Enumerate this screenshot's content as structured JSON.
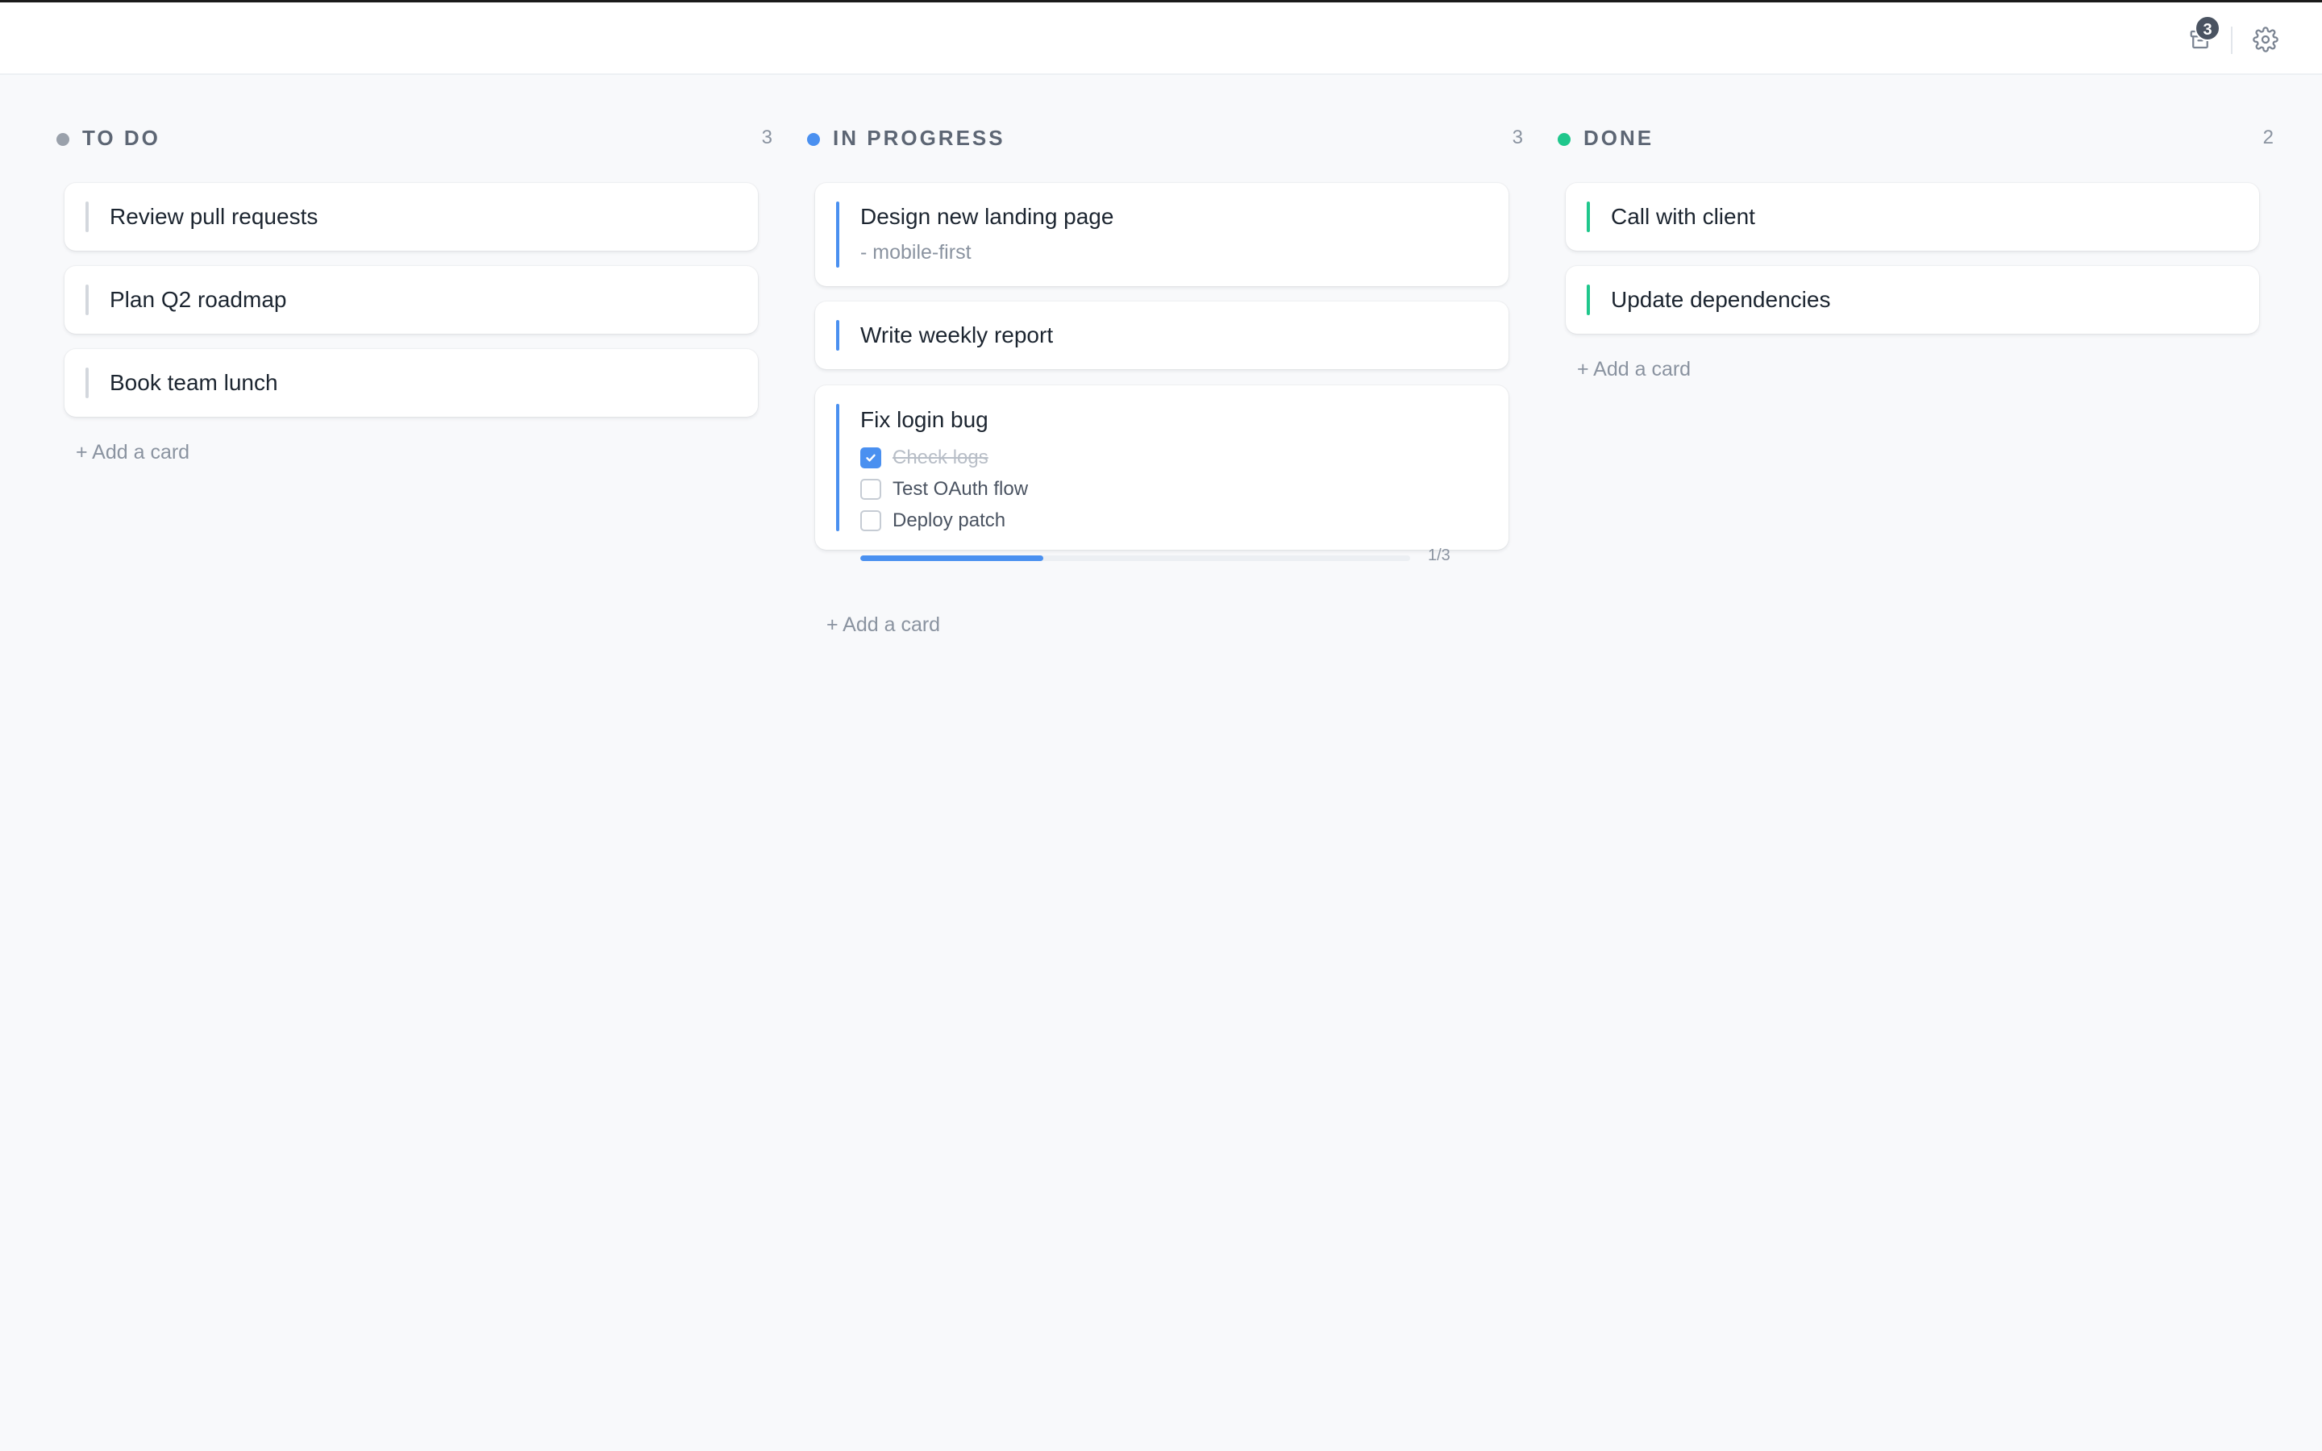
{
  "toolbar": {
    "archive_icon": "archive-box-icon",
    "archive_badge": "3",
    "settings_icon": "gear-icon"
  },
  "colors": {
    "todo": "#9aa1ab",
    "in_progress": "#4a90f0",
    "done": "#1fc78c"
  },
  "columns": [
    {
      "title": "TO DO",
      "count": "3",
      "cards": [
        {
          "title": "Review pull requests"
        },
        {
          "title": "Plan Q2 roadmap"
        },
        {
          "title": "Book team lunch"
        }
      ],
      "add_label": "+ Add a card"
    },
    {
      "title": "IN PROGRESS",
      "count": "3",
      "cards": [
        {
          "title": "Design new landing page",
          "subtitle": "- mobile-first"
        },
        {
          "title": "Write weekly report"
        },
        {
          "title": "Fix login bug",
          "checklist": [
            {
              "label": "Check logs",
              "checked": true
            },
            {
              "label": "Test OAuth flow",
              "checked": false
            },
            {
              "label": "Deploy patch",
              "checked": false
            }
          ],
          "progress": 0.3333,
          "progress_label": "1/3"
        }
      ],
      "add_label": "+ Add a card"
    },
    {
      "title": "DONE",
      "count": "2",
      "cards": [
        {
          "title": "Call with client"
        },
        {
          "title": "Update dependencies"
        }
      ],
      "add_label": "+ Add a card"
    }
  ]
}
